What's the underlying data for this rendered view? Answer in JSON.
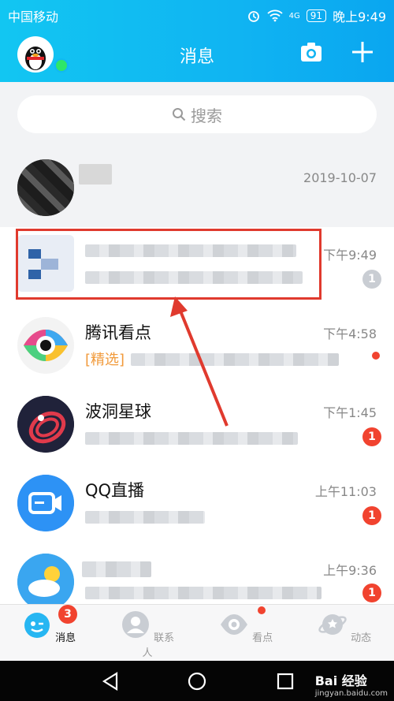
{
  "status_bar": {
    "carrier": "中国移动",
    "signal": "4G",
    "battery": "91",
    "time": "晚上9:49"
  },
  "header": {
    "title": "消息"
  },
  "search": {
    "placeholder": "搜索"
  },
  "chats": [
    {
      "name": "",
      "time": "2019-10-07",
      "preview": "",
      "badge": ""
    },
    {
      "name": "",
      "time": "下午9:49",
      "preview": "",
      "badge": "1"
    },
    {
      "name": "腾讯看点",
      "time": "下午4:58",
      "preview_tag": "[精选]",
      "preview": "",
      "badge": ""
    },
    {
      "name": "波洞星球",
      "time": "下午1:45",
      "preview": "",
      "badge": "1"
    },
    {
      "name": "QQ直播",
      "time": "上午11:03",
      "preview": "",
      "badge": "1"
    },
    {
      "name": "",
      "time": "上午9:36",
      "preview": "",
      "badge": "1"
    }
  ],
  "tabs": [
    {
      "label": "消息",
      "badge": "3"
    },
    {
      "label": "联系人"
    },
    {
      "label": "看点"
    },
    {
      "label": "动态"
    }
  ],
  "watermark": {
    "text": "Bai 经验",
    "sub": "jingyan.baidu.com"
  },
  "colors": {
    "header": "#10b4f2",
    "badge": "#f1432f",
    "highlight": "#e03a2e"
  }
}
